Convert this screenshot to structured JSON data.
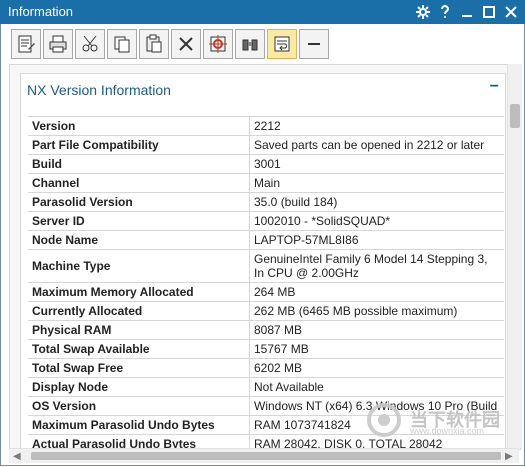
{
  "window": {
    "title": "Information"
  },
  "panel": {
    "title": "NX Version Information"
  },
  "rows": [
    {
      "label": "Version",
      "value": "2212"
    },
    {
      "label": "Part File Compatibility",
      "value": "Saved parts can be opened in 2212 or later"
    },
    {
      "label": "Build",
      "value": "3001"
    },
    {
      "label": "Channel",
      "value": "Main"
    },
    {
      "label": "Parasolid Version",
      "value": "35.0 (build 184)"
    },
    {
      "label": "Server ID",
      "value": "1002010 - *SolidSQUAD*"
    },
    {
      "label": "Node Name",
      "value": "LAPTOP-57ML8I86"
    },
    {
      "label": "Machine Type",
      "value": "GenuineIntel Family 6 Model 14 Stepping 3, In CPU @ 2.00GHz"
    },
    {
      "label": "Maximum Memory Allocated",
      "value": "264 MB"
    },
    {
      "label": "Currently Allocated",
      "value": "262 MB (6465 MB possible maximum)"
    },
    {
      "label": "Physical RAM",
      "value": "8087 MB"
    },
    {
      "label": "Total Swap Available",
      "value": "15767 MB"
    },
    {
      "label": "Total Swap Free",
      "value": "6202 MB"
    },
    {
      "label": "Display Node",
      "value": "Not Available"
    },
    {
      "label": "OS Version",
      "value": "Windows NT (x64) 6.3 Windows 10 Pro (Build"
    },
    {
      "label": "Maximum Parasolid Undo Bytes",
      "value": "RAM 1073741824"
    },
    {
      "label": "Actual Parasolid Undo Bytes",
      "value": "RAM 28042, DISK 0, TOTAL 28042"
    }
  ],
  "watermark": {
    "text": "当下软件园",
    "url": "www.downxia.com"
  }
}
